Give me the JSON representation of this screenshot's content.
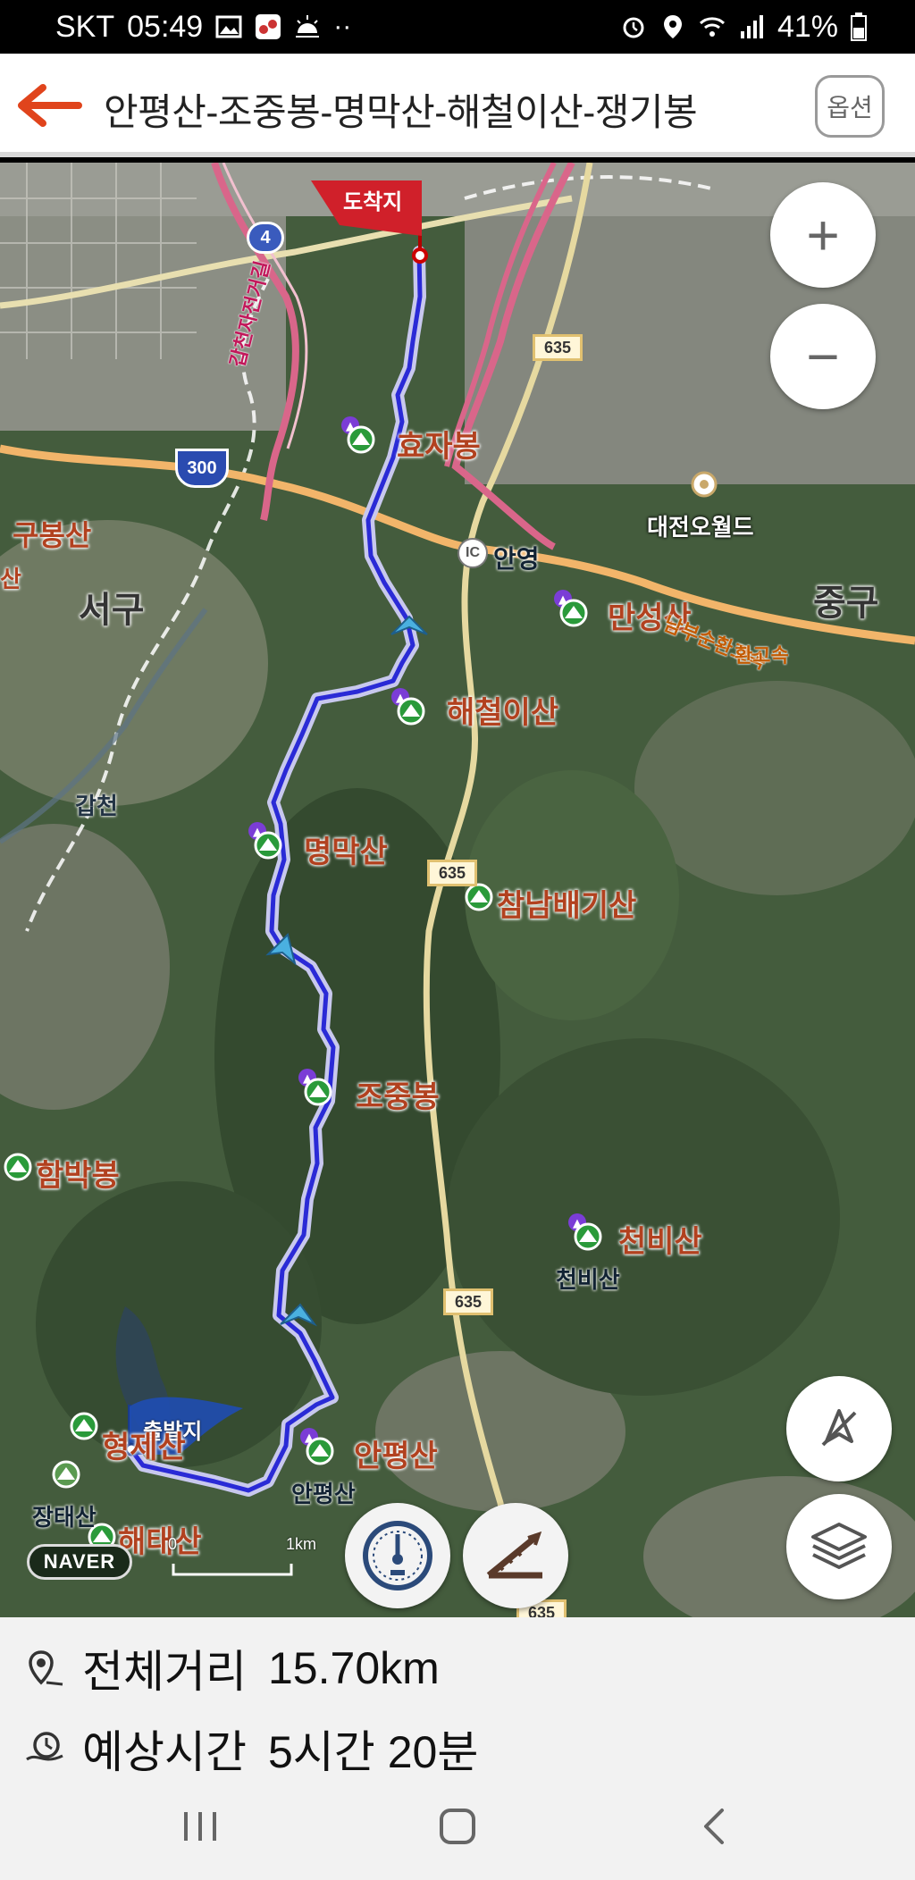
{
  "status_bar": {
    "carrier": "SKT",
    "time": "05:49",
    "battery": "41%",
    "icons_left": [
      "image-icon",
      "app-icon",
      "weather-icon",
      "more-dots-icon"
    ],
    "icons_right": [
      "alarm-icon",
      "location-icon",
      "wifi-icon",
      "signal-icon",
      "battery-icon"
    ]
  },
  "header": {
    "title": "안평산-조중봉-명막산-해철이산-쟁기봉",
    "option_label": "옵션"
  },
  "map": {
    "route_color": "#2a2ad6",
    "route_outline": "#b8b8e8",
    "arrival_flag": "도착지",
    "departure_flag": "출발지",
    "peaks": [
      {
        "name": "효자봉"
      },
      {
        "name": "해철이산"
      },
      {
        "name": "명막산"
      },
      {
        "name": "조중봉"
      },
      {
        "name": "안평산"
      },
      {
        "name": "만성산"
      },
      {
        "name": "참남배기산"
      },
      {
        "name": "천비산"
      },
      {
        "name": "함박봉"
      },
      {
        "name": "해태산"
      },
      {
        "name": "구봉산"
      },
      {
        "name": "형제산"
      }
    ],
    "areas": [
      {
        "name": "서구"
      },
      {
        "name": "중구"
      }
    ],
    "places": {
      "daejeon_oworld": "대전오월드",
      "anyeong": "안영",
      "ic": "IC",
      "gapcheon": "갑천",
      "gapcheon_bike": "갑천자전거길",
      "honam_expressway": "남부순환고속",
      "cheonbisan_small": "천비산",
      "anpyeongsan_small": "안평산",
      "jangtaesan": "장태산",
      "partial_label": "산"
    },
    "road_badges": {
      "route_4": "4",
      "route_300": "300",
      "route_635_a": "635",
      "route_635_b": "635",
      "route_635_c": "635",
      "route_635_d": "635"
    },
    "zoom_in": "+",
    "zoom_out": "−",
    "naver_logo": "NAVER",
    "scale_start": "0",
    "scale_end": "1km"
  },
  "info": {
    "distance_label": "전체거리",
    "distance_value": "15.70km",
    "time_label": "예상시간",
    "time_value": "5시간 20분"
  }
}
